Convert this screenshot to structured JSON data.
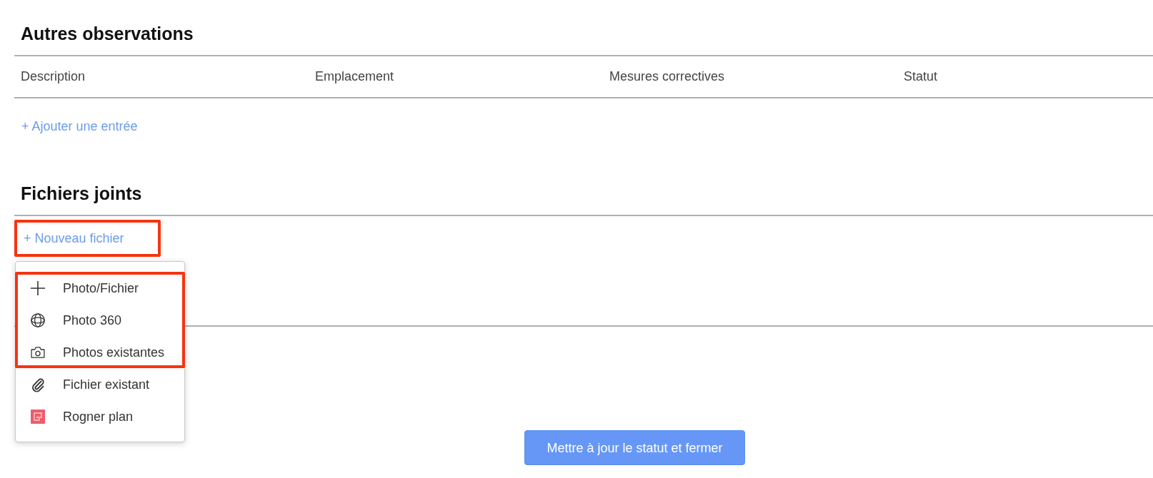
{
  "sections": [
    {
      "kind": "table",
      "title": "Autres observations",
      "columns": [
        "Description",
        "Emplacement",
        "Mesures correctives",
        "Statut"
      ],
      "add_link": "+ Ajouter une entrée"
    },
    {
      "kind": "attachments",
      "title": "Fichiers joints",
      "new_file": {
        "label": "+ Nouveau fichier",
        "highlighted": true
      },
      "menu": [
        {
          "label": "Photo/Fichier",
          "highlighted": true
        },
        {
          "label": "Photo 360",
          "highlighted": true
        },
        {
          "label": "Photos existantes",
          "highlighted": true
        },
        {
          "label": "Fichier existant",
          "highlighted": false
        },
        {
          "label": "Rogner plan",
          "highlighted": false
        }
      ]
    }
  ],
  "submit_button": "Mettre à jour le statut et fermer"
}
